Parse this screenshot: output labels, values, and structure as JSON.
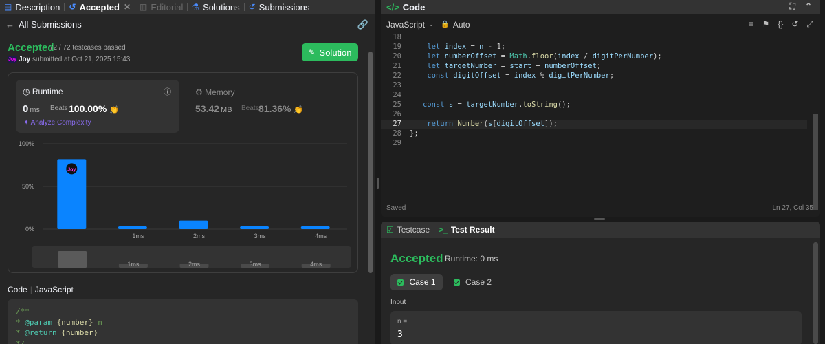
{
  "tabs": [
    {
      "label": "Description",
      "icon": "document-icon"
    },
    {
      "label": "Accepted",
      "icon": "history-icon"
    },
    {
      "label": "Editorial",
      "icon": "book-icon"
    },
    {
      "label": "Solutions",
      "icon": "flask-icon"
    },
    {
      "label": "Submissions",
      "icon": "history-icon"
    }
  ],
  "subheader": {
    "back_label": "All Submissions"
  },
  "status": {
    "title": "Accepted",
    "testcases": "72 / 72 testcases passed",
    "avatar_text": "Joy",
    "user": "Joy",
    "submitted_text": "submitted at Oct 21, 2025 15:43",
    "solution_button": "Solution"
  },
  "runtime": {
    "label": "Runtime",
    "value": "0",
    "unit": "ms",
    "beats_label": "Beats",
    "beats_pct": "100.00%",
    "analyze_label": "Analyze Complexity"
  },
  "memory": {
    "label": "Memory",
    "value": "53.42",
    "unit": "MB",
    "beats_label": "Beats",
    "beats_pct": "81.36%"
  },
  "chart_data": {
    "type": "bar",
    "categories": [
      "0ms",
      "1ms",
      "2ms",
      "3ms",
      "4ms"
    ],
    "x_tick_labels": [
      "",
      "1ms",
      "2ms",
      "3ms",
      "4ms"
    ],
    "values": [
      82,
      3,
      10,
      3,
      3
    ],
    "y_ticks": [
      "100%",
      "50%",
      "0%"
    ],
    "ylim": [
      0,
      100
    ],
    "marker_label": "Joy",
    "bar_color": "#0a84ff"
  },
  "code_section": {
    "label": "Code",
    "language": "JavaScript",
    "lines": [
      "/**",
      " * @param {number} n",
      " * @return {number}",
      " */"
    ]
  },
  "editor": {
    "title": "Code",
    "language": "JavaScript",
    "mode": "Auto",
    "lines": [
      {
        "n": "18",
        "t": ""
      },
      {
        "n": "19",
        "t": "    let index = n - 1;"
      },
      {
        "n": "20",
        "t": "    let numberOffset = Math.floor(index / digitPerNumber);"
      },
      {
        "n": "21",
        "t": "    let targetNumber = start + numberOffset;"
      },
      {
        "n": "22",
        "t": "    const digitOffset = index % digitPerNumber;"
      },
      {
        "n": "23",
        "t": ""
      },
      {
        "n": "24",
        "t": ""
      },
      {
        "n": "25",
        "t": "   const s = targetNumber.toString();"
      },
      {
        "n": "26",
        "t": ""
      },
      {
        "n": "27",
        "t": "    return Number(s[digitOffset]);"
      },
      {
        "n": "28",
        "t": "};"
      },
      {
        "n": "29",
        "t": ""
      }
    ],
    "saved": "Saved",
    "position": "Ln 27, Col 35"
  },
  "testpanel": {
    "testcase_tab": "Testcase",
    "result_tab": "Test Result",
    "result": "Accepted",
    "runtime": "Runtime: 0 ms",
    "case1": "Case 1",
    "case2": "Case 2",
    "input_label": "Input",
    "input_name": "n =",
    "input_value": "3"
  },
  "colors": {
    "accent_green": "#2cbb5d",
    "bar_blue": "#0a84ff",
    "purple": "#8b6df2"
  }
}
